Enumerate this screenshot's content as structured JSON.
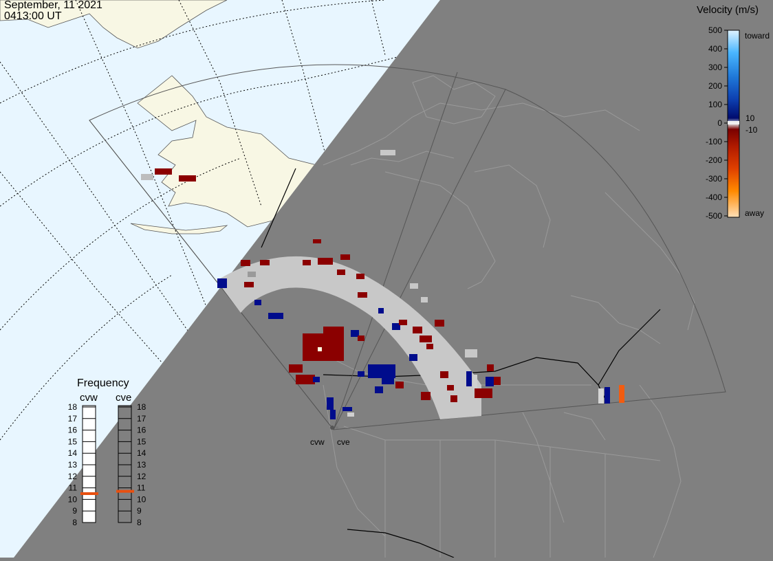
{
  "header": {
    "date": "September, 11 2021",
    "time": "0413:00 UT"
  },
  "velocity_scale": {
    "title": "Velocity (m/s)",
    "ticks": [
      "500",
      "400",
      "300",
      "200",
      "100",
      "10",
      "0",
      "-10",
      "-100",
      "-200",
      "-300",
      "-400",
      "-500"
    ],
    "toward_label": "toward",
    "away_label": "away"
  },
  "frequency_panel": {
    "title": "Frequency",
    "left_radar": "cvw",
    "right_radar": "cve",
    "ticks": [
      "18",
      "17",
      "16",
      "15",
      "14",
      "13",
      "12",
      "11",
      "10",
      "9",
      "8"
    ],
    "cvw_marker_mhz": 10.5,
    "cve_marker_mhz": 10.7
  },
  "radar_labels": {
    "cvw": "cvw",
    "cve": "cve"
  },
  "colors": {
    "night": "#808080",
    "ocean_day": "#e8f6ff",
    "land_day": "#f8f7e4",
    "ground_scatter": "#c8c8c8",
    "toward": "#000c8c",
    "away_dark": "#8b0000",
    "away_orange": "#f25c10"
  }
}
